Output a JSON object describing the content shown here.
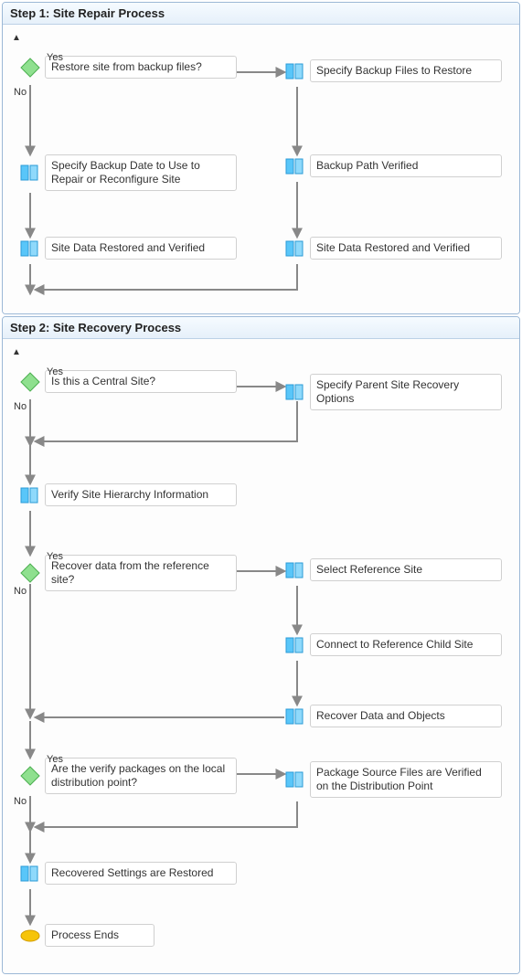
{
  "step1": {
    "title": "Step 1: Site Repair Process",
    "labels": {
      "yes": "Yes",
      "no": "No"
    },
    "nodes": {
      "restore_q": "Restore site from backup files?",
      "specify_backup": "Specify Backup Files to Restore",
      "specify_date": "Specify Backup Date to Use to Repair or Reconfigure Site",
      "backup_verified": "Backup Path Verified",
      "restored_left": "Site Data Restored and Verified",
      "restored_right": "Site Data Restored and Verified"
    }
  },
  "step2": {
    "title": "Step 2: Site Recovery Process",
    "labels": {
      "yes": "Yes",
      "no": "No"
    },
    "nodes": {
      "central_q": "Is this a Central Site?",
      "parent_opts": "Specify Parent Site Recovery Options",
      "verify_hierarchy": "Verify Site Hierarchy Information",
      "recover_ref_q": "Recover data from the reference site?",
      "select_ref": "Select Reference Site",
      "connect_ref": "Connect to Reference Child Site",
      "recover_data": "Recover Data and Objects",
      "verify_pkg_q": "Are the verify packages on the local distribution point?",
      "pkg_verified": "Package Source Files are Verified on the Distribution Point",
      "recovered_restored": "Recovered Settings are Restored",
      "process_ends": "Process Ends"
    }
  }
}
